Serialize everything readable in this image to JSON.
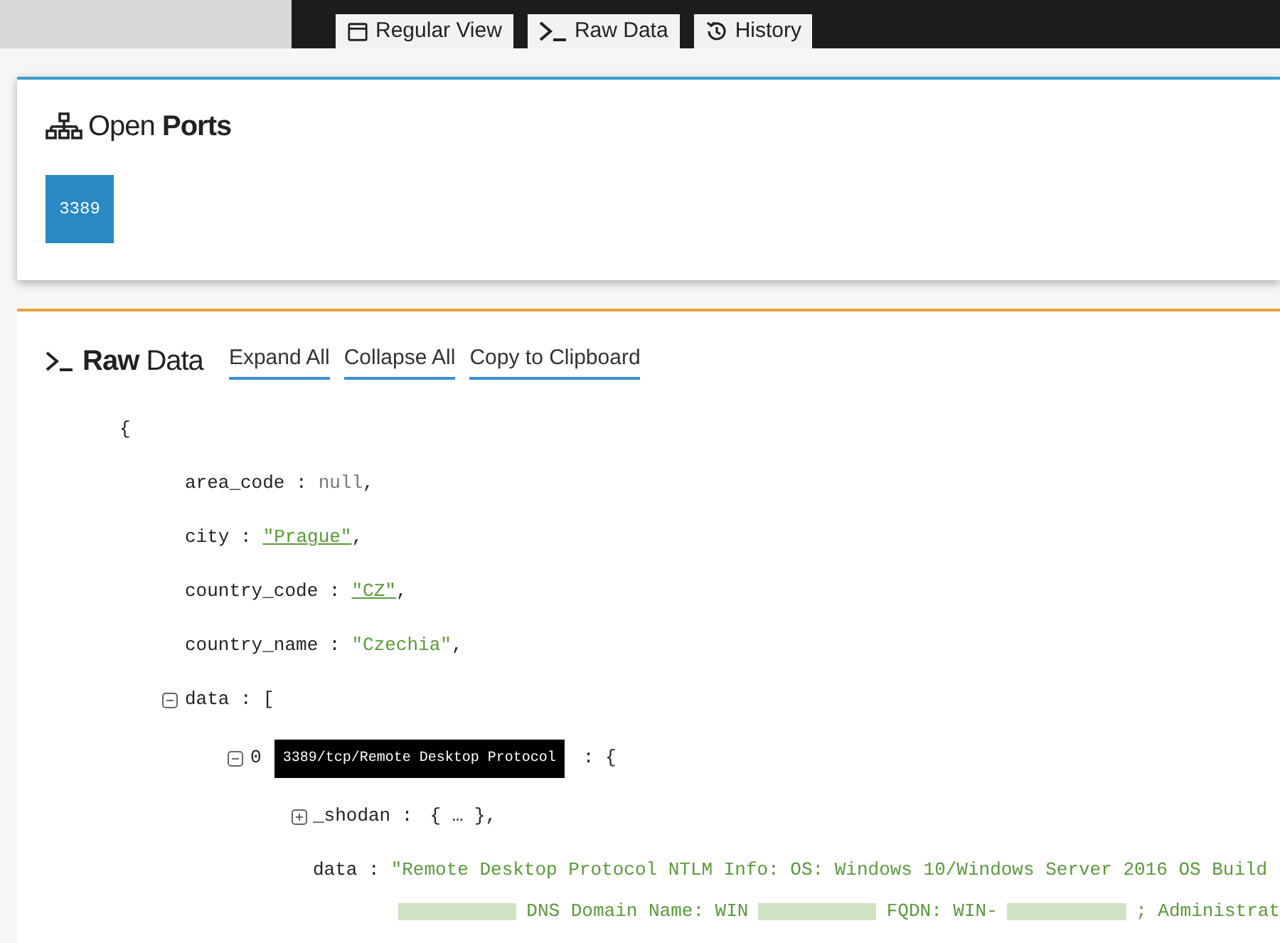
{
  "tabs": [
    {
      "label": "Regular View",
      "kind": "window"
    },
    {
      "label": "Raw Data",
      "kind": "terminal"
    },
    {
      "label": "History",
      "kind": "history"
    }
  ],
  "open_ports": {
    "title_light": "Open",
    "title_bold": "Ports",
    "ports": [
      "3389"
    ]
  },
  "raw_data": {
    "title_bold": "Raw",
    "title_light": "Data",
    "actions": [
      "Expand All",
      "Collapse All",
      "Copy to Clipboard"
    ],
    "open_brace": "{",
    "fields": [
      {
        "key": "area_code :",
        "value": "null",
        "kind": "null",
        "suffix": ","
      },
      {
        "key": "city :",
        "value": "\"Prague\"",
        "kind": "link",
        "suffix": ","
      },
      {
        "key": "country_code :",
        "value": "\"CZ\"",
        "kind": "link",
        "suffix": ","
      },
      {
        "key": "country_name :",
        "value": "\"Czechia\"",
        "kind": "string",
        "suffix": ","
      }
    ],
    "data_node": {
      "key": "data :",
      "bracket": "[",
      "expanded": true,
      "items": [
        {
          "index": "0",
          "label": "3389/tcp/Remote Desktop Protocol",
          "brace": ": {",
          "expanded": true,
          "shodan": {
            "key": "_shodan :",
            "collapsed": "{ … },",
            "expanded": false
          },
          "data_key": "data :",
          "data_value": "\"Remote Desktop Protocol NTLM Info: OS: Windows 10/Windows Server 2016 OS Build",
          "continuation": [
            {
              "kind": "redacted"
            },
            {
              "kind": "text",
              "text": "DNS Domain Name: WIN"
            },
            {
              "kind": "redacted"
            },
            {
              "kind": "text",
              "text": "FQDN: WIN-"
            },
            {
              "kind": "redacted"
            },
            {
              "kind": "text",
              "text": "; Administrat"
            }
          ]
        }
      ]
    }
  }
}
